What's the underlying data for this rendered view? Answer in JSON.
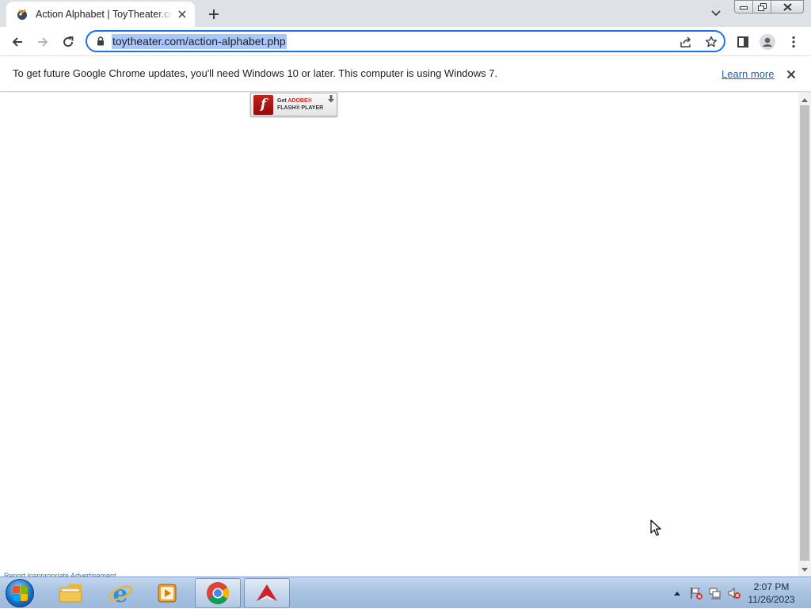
{
  "browser": {
    "tab_title": "Action Alphabet | ToyTheater.com",
    "url": "toytheater.com/action-alphabet.php"
  },
  "infobar": {
    "message": "To get future Google Chrome updates, you'll need Windows 10 or later. This computer is using Windows 7.",
    "link_label": "Learn more"
  },
  "page": {
    "flash_badge": {
      "line1_prefix": "Get",
      "line1_brand": "ADOBE®",
      "line2": "FLASH® PLAYER",
      "logo_letter": "f"
    },
    "report_link": "Report inappropriate Advertisement"
  },
  "taskbar": {
    "apps": [
      "explorer",
      "internet-explorer",
      "media-player",
      "chrome",
      "flash-player"
    ],
    "active_app": "chrome",
    "time": "2:07 PM",
    "date": "11/26/2023"
  },
  "colors": {
    "accent": "#1a73e8",
    "url_highlight": "#a8c7fa",
    "tabstrip_bg": "#dee1e6",
    "link": "#1a5fb4"
  }
}
